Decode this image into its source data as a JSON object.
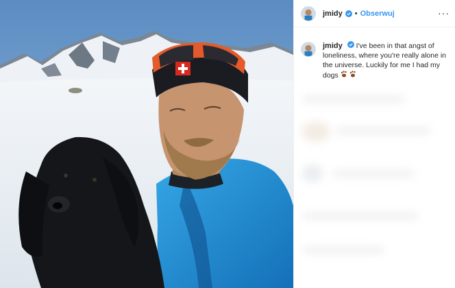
{
  "post": {
    "username": "jmidy",
    "separator": "•",
    "follow_label": "Obserwuj",
    "more_label": "···",
    "caption_text": "I've been in that angst of loneliness, where you're really alone in the universe. Luckily for me I had my dogs",
    "caption_emoji": "paw-prints",
    "accent_color": "#3897f0"
  }
}
